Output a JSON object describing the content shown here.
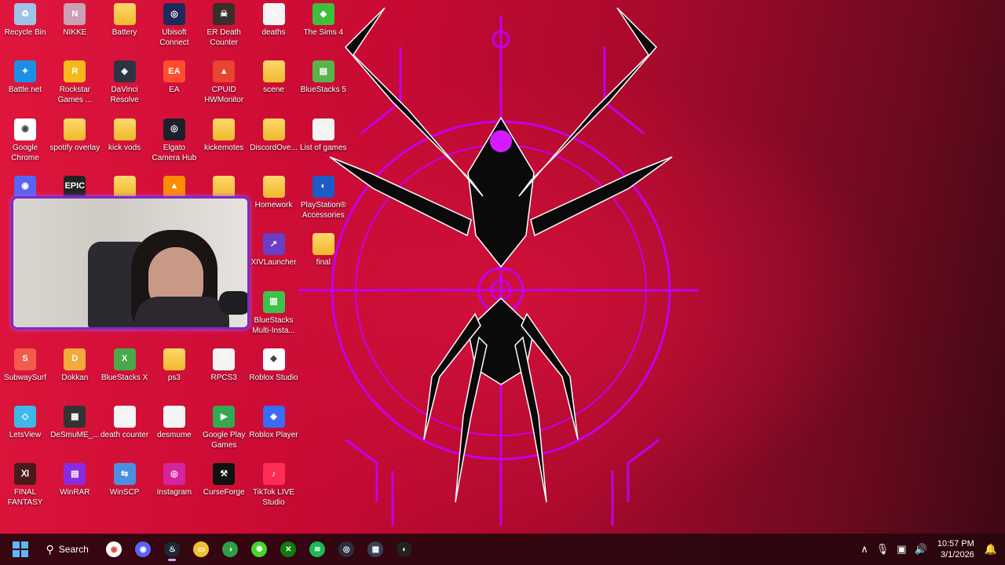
{
  "desktop": {
    "icons": [
      {
        "label": "Recycle Bin",
        "icon": "recycle-bin-icon",
        "color": "#9fc3e6",
        "glyph": "♻"
      },
      {
        "label": "NIKKE",
        "icon": "nikke-icon",
        "color": "#c9a0b4",
        "glyph": "N"
      },
      {
        "label": "Battery",
        "icon": "folder-icon",
        "color": "",
        "glyph": ""
      },
      {
        "label": "Ubisoft Connect",
        "icon": "ubisoft-icon",
        "color": "#1d2a5c",
        "glyph": "◎"
      },
      {
        "label": "ER Death Counter",
        "icon": "er-death-counter-icon",
        "color": "#3a2d2a",
        "glyph": "☠"
      },
      {
        "label": "deaths",
        "icon": "text-file-icon",
        "color": "",
        "glyph": ""
      },
      {
        "label": "The Sims 4",
        "icon": "sims-icon",
        "color": "#3fbf3a",
        "glyph": "◆"
      },
      {
        "label": "Battle.net",
        "icon": "battlenet-icon",
        "color": "#1b8fe6",
        "glyph": "✦"
      },
      {
        "label": "Rockstar Games ...",
        "icon": "rockstar-icon",
        "color": "#f6b81a",
        "glyph": "R"
      },
      {
        "label": "DaVinci Resolve",
        "icon": "davinci-icon",
        "color": "#2c3443",
        "glyph": "◈"
      },
      {
        "label": "EA",
        "icon": "ea-icon",
        "color": "#ff4e2c",
        "glyph": "EA"
      },
      {
        "label": "CPUID HWMonitor",
        "icon": "hwmonitor-icon",
        "color": "#e7452f",
        "glyph": "▲"
      },
      {
        "label": "scene",
        "icon": "folder-icon",
        "color": "",
        "glyph": ""
      },
      {
        "label": "BlueStacks 5",
        "icon": "bluestacks-icon",
        "color": "#5ab24b",
        "glyph": "▤"
      },
      {
        "label": "Google Chrome",
        "icon": "chrome-icon",
        "color": "#ffffff",
        "glyph": "◉"
      },
      {
        "label": "spotify overlay",
        "icon": "folder-icon",
        "color": "",
        "glyph": ""
      },
      {
        "label": "kick vods",
        "icon": "folder-icon",
        "color": "",
        "glyph": ""
      },
      {
        "label": "Elgato Camera Hub",
        "icon": "elgato-icon",
        "color": "#1d1f2b",
        "glyph": "◎"
      },
      {
        "label": "kickemotes",
        "icon": "folder-icon",
        "color": "",
        "glyph": ""
      },
      {
        "label": "DiscordOve...",
        "icon": "folder-icon",
        "color": "",
        "glyph": ""
      },
      {
        "label": "List of games",
        "icon": "text-file-icon",
        "color": "",
        "glyph": ""
      },
      {
        "label": "Homework",
        "icon": "folder-icon",
        "color": "",
        "glyph": ""
      },
      {
        "label": "PlayStation® Accessories",
        "icon": "playstation-icon",
        "color": "#1e5ac8",
        "glyph": "◐"
      },
      {
        "label": "XIVLauncher",
        "icon": "xivlauncher-icon",
        "color": "#6a3fc7",
        "glyph": "↗"
      },
      {
        "label": "final",
        "icon": "folder-icon",
        "color": "",
        "glyph": ""
      },
      {
        "label": "BlueStacks Multi-Insta...",
        "icon": "bluestacks-multi-icon",
        "color": "#3fc24a",
        "glyph": "▥"
      },
      {
        "label": "SubwaySurf",
        "icon": "subwaysurf-icon",
        "color": "#f25a4a",
        "glyph": "S"
      },
      {
        "label": "Dokkan",
        "icon": "dokkan-icon",
        "color": "#f4a93a",
        "glyph": "D"
      },
      {
        "label": "BlueStacks X",
        "icon": "bluestacks-x-icon",
        "color": "#4aa84a",
        "glyph": "X"
      },
      {
        "label": "ps3",
        "icon": "folder-icon",
        "color": "",
        "glyph": ""
      },
      {
        "label": "RPCS3",
        "icon": "text-file-icon",
        "color": "",
        "glyph": ""
      },
      {
        "label": "Roblox Studio",
        "icon": "roblox-studio-icon",
        "color": "#ffffff",
        "glyph": "◆"
      },
      {
        "label": "LetsView",
        "icon": "letsview-icon",
        "color": "#3fb8e8",
        "glyph": "◇"
      },
      {
        "label": "DeSmuME_...",
        "icon": "desmume-icon",
        "color": "#333333",
        "glyph": "▦"
      },
      {
        "label": "death counter",
        "icon": "text-file-icon",
        "color": "",
        "glyph": ""
      },
      {
        "label": "desmume",
        "icon": "text-file-icon",
        "color": "",
        "glyph": ""
      },
      {
        "label": "Google Play Games",
        "icon": "play-games-icon",
        "color": "#34a853",
        "glyph": "▶"
      },
      {
        "label": "Roblox Player",
        "icon": "roblox-player-icon",
        "color": "#3a6cf4",
        "glyph": "◆"
      },
      {
        "label": "FINAL FANTASY XI...",
        "icon": "ffxiv-icon",
        "color": "#4a1a1a",
        "glyph": "Ⅺ"
      },
      {
        "label": "WinRAR",
        "icon": "winrar-icon",
        "color": "#8a2be2",
        "glyph": "▤"
      },
      {
        "label": "WinSCP",
        "icon": "winscp-icon",
        "color": "#4a90e2",
        "glyph": "⇆"
      },
      {
        "label": "Instagram",
        "icon": "instagram-icon",
        "color": "#d6249f",
        "glyph": "◎"
      },
      {
        "label": "CurseForge",
        "icon": "curseforge-icon",
        "color": "#111111",
        "glyph": "⚒"
      },
      {
        "label": "TikTok LIVE Studio",
        "icon": "tiktok-live-icon",
        "color": "#ff2d55",
        "glyph": "♪"
      },
      {
        "label": "",
        "icon": "discord-icon",
        "color": "#5865f2",
        "glyph": "◉"
      },
      {
        "label": "",
        "icon": "epic-games-icon",
        "color": "#222222",
        "glyph": "EPIC"
      },
      {
        "label": "",
        "icon": "folder-icon",
        "color": "",
        "glyph": ""
      },
      {
        "label": "",
        "icon": "vlc-icon",
        "color": "#ff8c00",
        "glyph": "▲"
      },
      {
        "label": "",
        "icon": "folder-icon",
        "color": "",
        "glyph": ""
      }
    ]
  },
  "taskbar": {
    "search_label": "Search",
    "apps": [
      {
        "name": "chrome-icon",
        "color": "#ffffff",
        "glyph": "◉"
      },
      {
        "name": "discord-icon",
        "color": "#5865f2",
        "glyph": "◉"
      },
      {
        "name": "steam-icon",
        "color": "#1b2838",
        "glyph": "♨"
      },
      {
        "name": "file-explorer-icon",
        "color": "#f2c037",
        "glyph": "▭"
      },
      {
        "name": "xbox-app-icon",
        "color": "#2ea043",
        "glyph": "◑"
      },
      {
        "name": "razer-icon",
        "color": "#44d62c",
        "glyph": "✺"
      },
      {
        "name": "xbox-icon",
        "color": "#107c10",
        "glyph": "✕"
      },
      {
        "name": "spotify-icon",
        "color": "#1db954",
        "glyph": "≋"
      },
      {
        "name": "elgato-camera-icon",
        "color": "#2d2f3e",
        "glyph": "◎"
      },
      {
        "name": "wave-link-icon",
        "color": "#3a3f57",
        "glyph": "▦"
      },
      {
        "name": "obs-icon",
        "color": "#222222",
        "glyph": "◐"
      }
    ],
    "tray": {
      "time": "10:57 PM",
      "date": "3/1/2026"
    }
  },
  "webcam": {
    "overlay_color": "#7a2cc4"
  }
}
